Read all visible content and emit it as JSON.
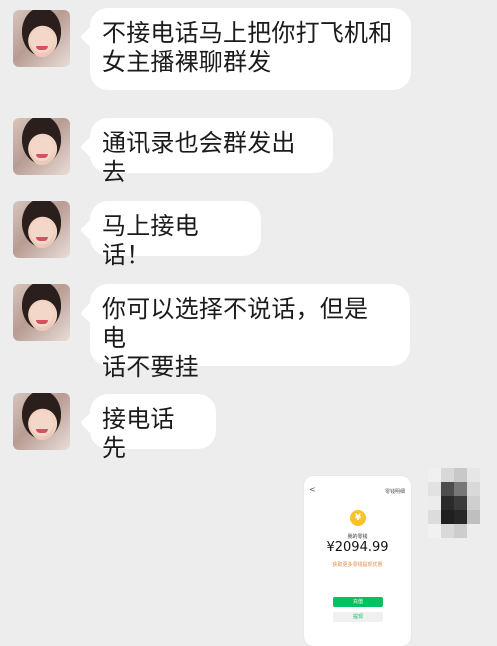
{
  "messages": [
    {
      "text": "不接电话马上把你打飞机和\n女主播裸聊群发"
    },
    {
      "text": "通讯录也会群发出去"
    },
    {
      "text": "马上接电话！"
    },
    {
      "text": "你可以选择不说话，但是电\n话不要挂"
    },
    {
      "text": "接电话先"
    }
  ],
  "image_message": {
    "back": "<",
    "title": "零钱明细",
    "coin": "¥",
    "label": "我的零钱",
    "amount": "¥2094.99",
    "note": "获取更多零钱提现优惠",
    "primary_button": "充值",
    "secondary_button": "提现"
  },
  "colors": {
    "background": "#ededed",
    "bubble": "#ffffff",
    "green": "#07c160",
    "coin": "#f7c22b"
  },
  "icons": {
    "contact_avatar": "avatar-photo-icon",
    "self_avatar": "mosaic-avatar-icon",
    "coin": "yuan-coin-icon"
  }
}
